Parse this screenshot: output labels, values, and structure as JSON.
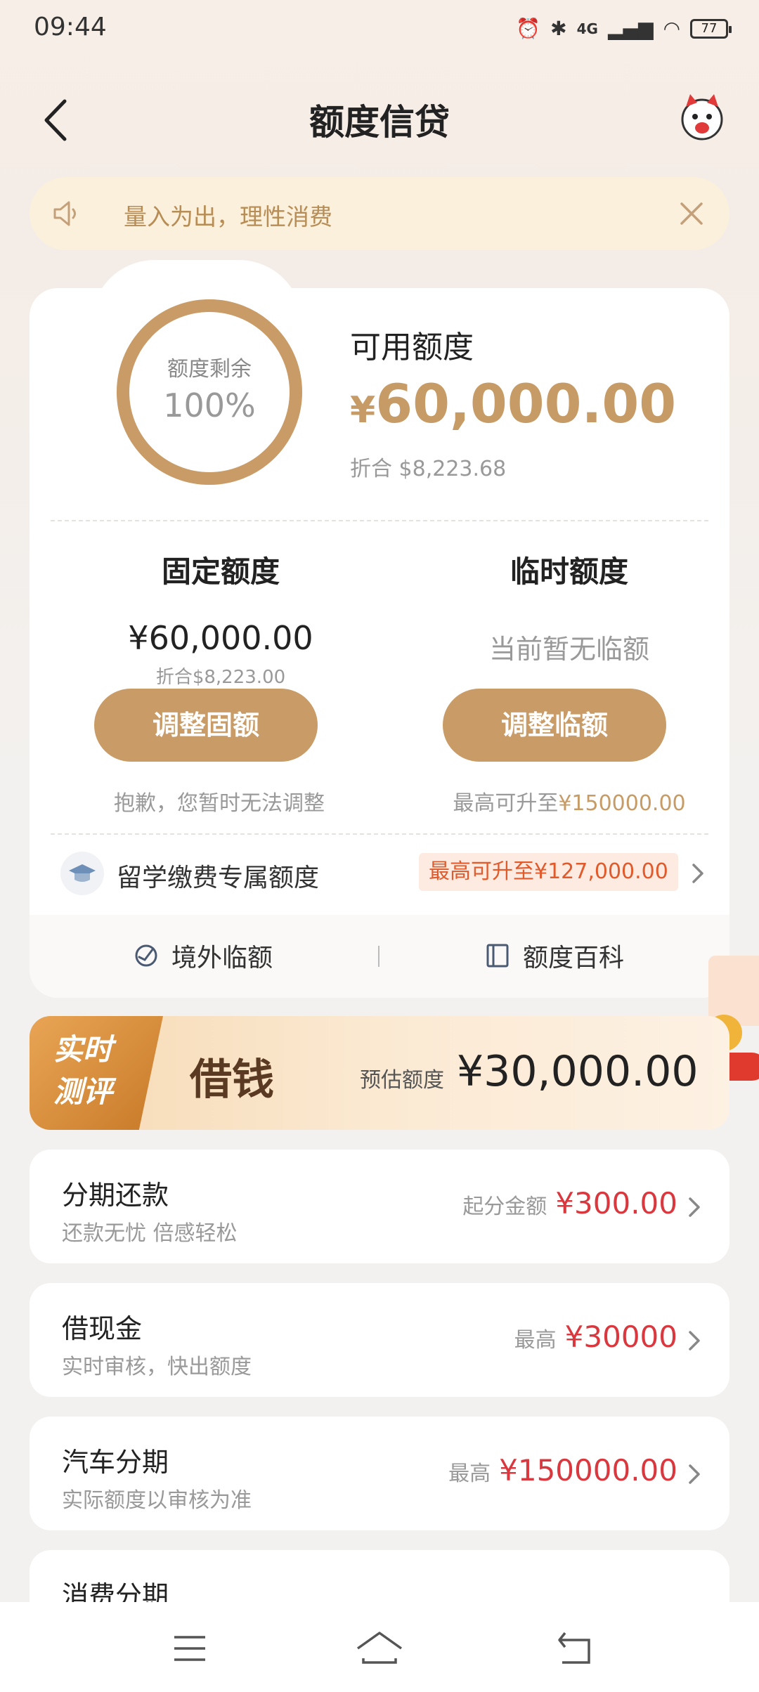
{
  "status_bar": {
    "time": "09:44",
    "network": "4G",
    "battery": "77"
  },
  "header": {
    "title": "额度信贷"
  },
  "notice": {
    "text": "量入为出，理性消费"
  },
  "credit": {
    "ring_label": "额度剩余",
    "ring_value": "100%",
    "remaining_fraction": 1.0,
    "available_label": "可用额度",
    "available_currency": "¥",
    "available_amount": "60,000.00",
    "available_conversion": "折合  $8,223.68",
    "fixed": {
      "title": "固定额度",
      "amount": "¥60,000.00",
      "conversion": "折合$8,223.00",
      "button": "调整固额",
      "note": "抱歉，您暂时无法调整"
    },
    "temporary": {
      "title": "临时额度",
      "status": "当前暂无临额",
      "button": "调整临额",
      "note_prefix": "最高可升至",
      "note_amount": "¥150000.00"
    },
    "study": {
      "label": "留学缴费专属额度",
      "badge": "最高可升至¥127,000.00"
    },
    "tools": [
      {
        "label": "境外临额",
        "icon": "refresh-globe-icon"
      },
      {
        "label": "额度百科",
        "icon": "book-icon"
      }
    ]
  },
  "loan_banner": {
    "tag_line1": "实时",
    "tag_line2": "测评",
    "title": "借钱",
    "estimate_label": "预估额度",
    "estimate_value": "¥30,000.00"
  },
  "products": [
    {
      "title": "分期还款",
      "subtitle": "还款无忧 倍感轻松",
      "prefix": "起分金额",
      "amount": "¥300.00"
    },
    {
      "title": "借现金",
      "subtitle": "实时审核，快出额度",
      "prefix": "最高",
      "amount": "¥30000"
    },
    {
      "title": "汽车分期",
      "subtitle": "实际额度以审核为准",
      "prefix": "最高",
      "amount": "¥150000.00"
    },
    {
      "title": "消费分期",
      "subtitle": "",
      "prefix": "",
      "amount": ""
    }
  ],
  "colors": {
    "accent": "#c99b66",
    "price_red": "#d9383e",
    "badge_orange": "#e05a2c"
  }
}
